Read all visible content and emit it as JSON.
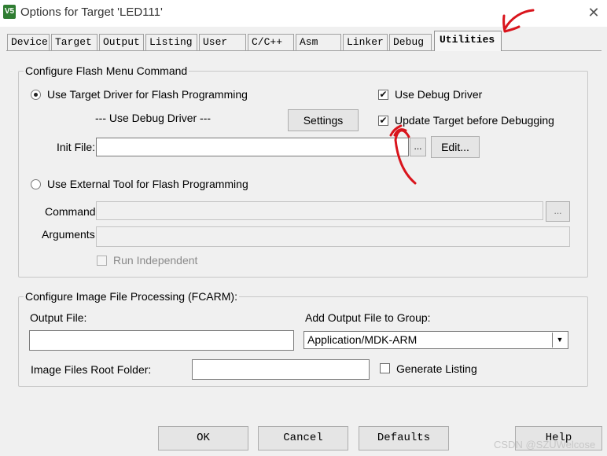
{
  "window": {
    "title": "Options for Target 'LED111'",
    "icon_text": "V5",
    "close_glyph": "✕"
  },
  "tabs": [
    {
      "label": "Device"
    },
    {
      "label": "Target"
    },
    {
      "label": "Output"
    },
    {
      "label": "Listing"
    },
    {
      "label": "User"
    },
    {
      "label": "C/C++"
    },
    {
      "label": "Asm"
    },
    {
      "label": "Linker"
    },
    {
      "label": "Debug"
    },
    {
      "label": "Utilities",
      "active": true
    }
  ],
  "flash_group": {
    "legend": "Configure Flash Menu Command",
    "use_target_driver_label": "Use Target Driver for Flash Programming",
    "use_target_driver_selected": true,
    "debug_driver_note": "--- Use Debug Driver ---",
    "settings_label": "Settings",
    "use_debug_driver_label": "Use Debug Driver",
    "use_debug_driver_checked": true,
    "update_target_label": "Update Target before Debugging",
    "update_target_checked": true,
    "init_file_label": "Init File:",
    "init_file_value": "",
    "browse_label": "...",
    "edit_label": "Edit...",
    "use_external_tool_label": "Use External Tool for Flash Programming",
    "use_external_tool_selected": false,
    "command_label": "Command:",
    "command_value": "",
    "command_browse_label": "...",
    "arguments_label": "Arguments:",
    "arguments_value": "",
    "run_independent_label": "Run Independent",
    "run_independent_checked": false
  },
  "image_group": {
    "legend": "Configure Image File Processing (FCARM):",
    "output_file_label": "Output File:",
    "output_file_value": "",
    "add_to_group_label": "Add Output File  to Group:",
    "add_to_group_value": "Application/MDK-ARM",
    "root_folder_label": "Image Files Root Folder:",
    "root_folder_value": "",
    "generate_listing_label": "Generate Listing",
    "generate_listing_checked": false
  },
  "footer": {
    "ok_label": "OK",
    "cancel_label": "Cancel",
    "defaults_label": "Defaults",
    "help_label": "Help"
  },
  "check_glyph": "✔",
  "dropdown_glyph": "▼",
  "watermark": "CSDN @SZUWelcose",
  "annotation_color": "#d9141c"
}
